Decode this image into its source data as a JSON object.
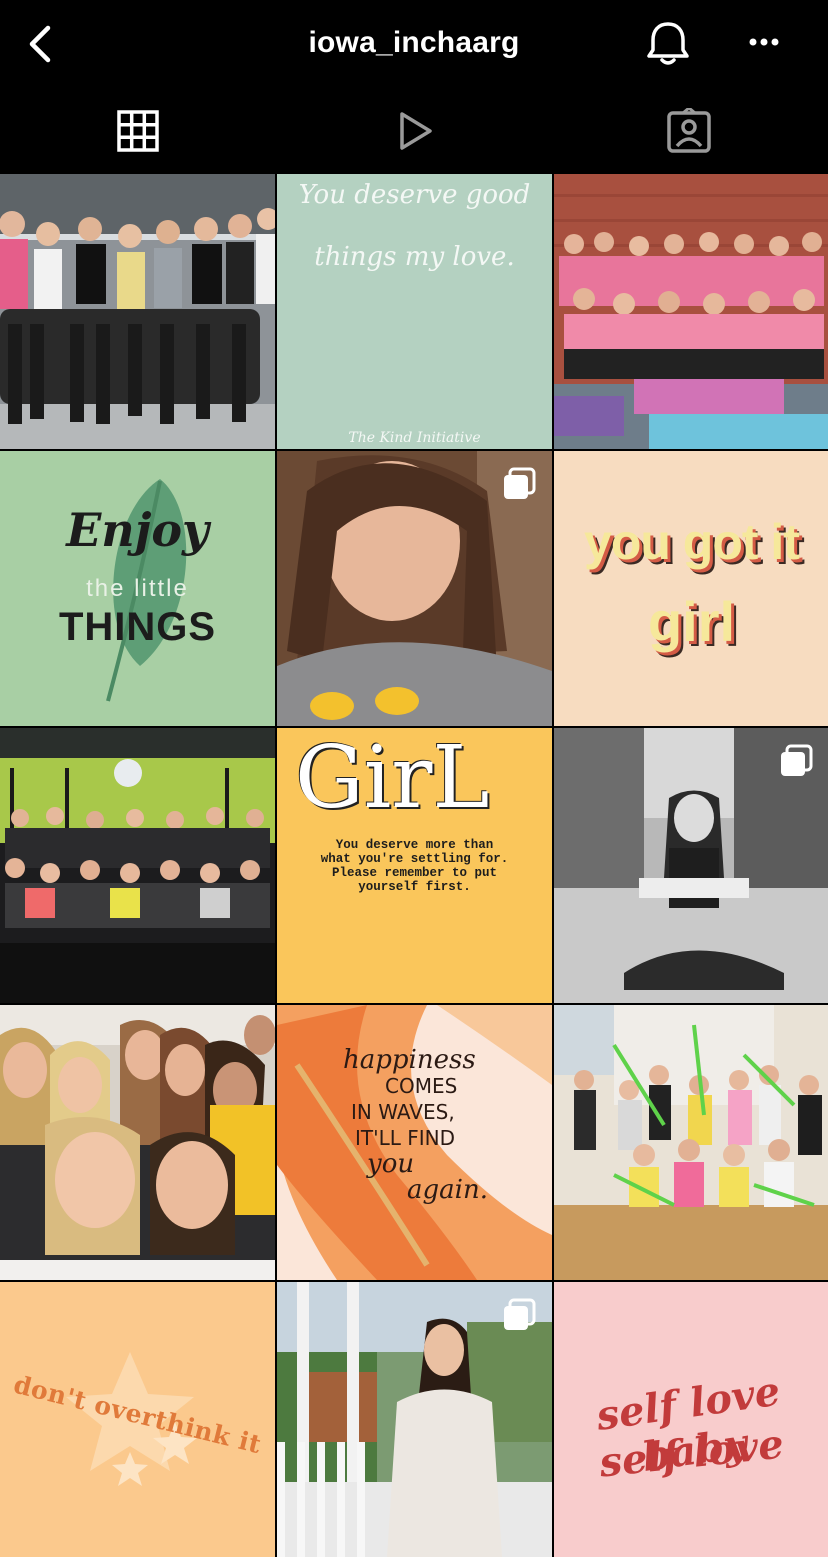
{
  "header": {
    "username": "iowa_inchaarg",
    "back_icon": "chevron-left-icon",
    "notification_icon": "bell-icon",
    "more_icon": "more-horizontal-icon"
  },
  "tabs": [
    {
      "name": "grid",
      "icon": "grid-icon",
      "active": true
    },
    {
      "name": "reels",
      "icon": "play-icon",
      "active": false
    },
    {
      "name": "tagged",
      "icon": "tagged-person-icon",
      "active": false
    }
  ],
  "posts": {
    "p1": {
      "kind": "photo-group-gym"
    },
    "p2": {
      "line1": "You deserve good",
      "line2": "things my love.",
      "footer": "The Kind Initiative"
    },
    "p3": {
      "kind": "photo-group-pink"
    },
    "p4": {
      "word1": "Enjoy",
      "word2": "the little",
      "word3": "THINGS"
    },
    "p5": {
      "kind": "photo-selfie",
      "multi": true
    },
    "p6": {
      "line1": "you got it",
      "line2": "girl"
    },
    "p7": {
      "kind": "photo-group-fitness"
    },
    "p8": {
      "title": "GirL",
      "body": [
        "You deserve more than",
        "what you're settling for.",
        "Please remember to put",
        "yourself first."
      ]
    },
    "p9": {
      "kind": "photo-bw-portrait",
      "multi": true
    },
    "p10": {
      "kind": "photo-selfie-group"
    },
    "p11": {
      "lines": [
        "happiness",
        "COMES",
        "IN WAVES,",
        "IT'LL FIND",
        "you",
        "again."
      ]
    },
    "p12": {
      "kind": "photo-group-dance"
    },
    "p13": {
      "text": "don't overthink it"
    },
    "p14": {
      "kind": "photo-portrait-outdoor",
      "multi": true
    },
    "p15": {
      "line1": "self love baby",
      "line2": "self love"
    }
  },
  "colors": {
    "background": "#000000",
    "pale_green": "#b4d1c1",
    "mint": "#a8cfa4",
    "cream": "#f7dcc0",
    "yellow": "#fac65b",
    "peach": "#fbc98d",
    "pink": "#f8cccc",
    "red_text": "#c23b3b"
  }
}
